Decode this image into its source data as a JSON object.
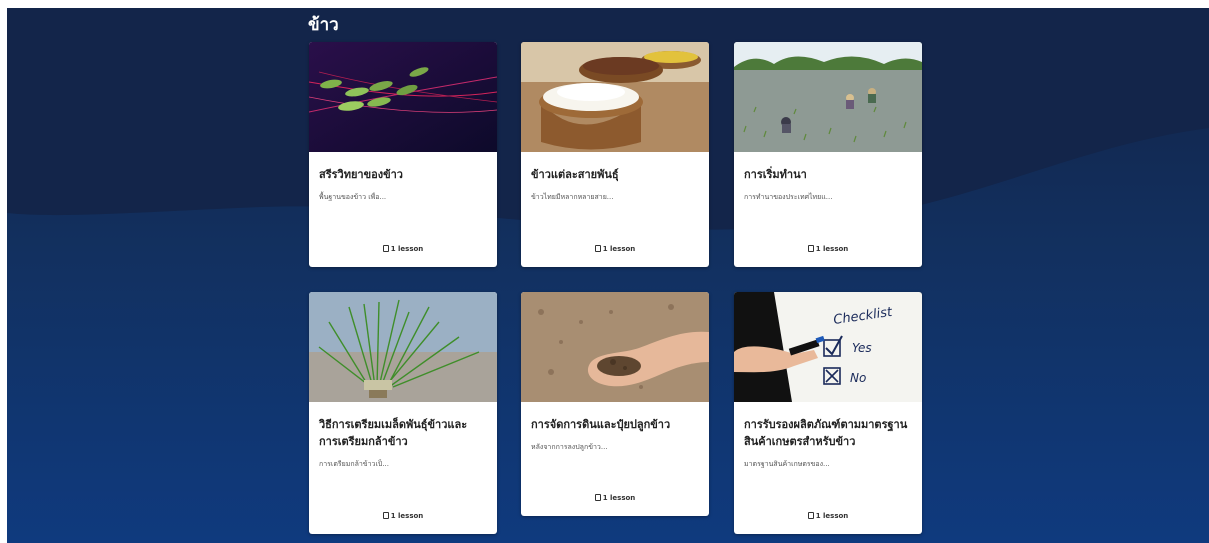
{
  "section": {
    "title": "ข้าว"
  },
  "courses": [
    {
      "title": "สรีรวิทยาของข้าว",
      "description": "พื้นฐานของข้าว เพื่อ...",
      "lessons": "1 lesson",
      "image": "rice-grain-closeup"
    },
    {
      "title": "ข้าวแต่ละสายพันธุ์",
      "description": "ข้าวไทยมีหลากหลายสาย...",
      "lessons": "1 lesson",
      "image": "rice-bowls"
    },
    {
      "title": "การเริ่มทำนา",
      "description": "การทำนาของประเทศไทยแ...",
      "lessons": "1 lesson",
      "image": "rice-planting-field"
    },
    {
      "title": "วิธีการเตรียมเมล็ดพันธุ์ข้าวและการเตรียมกล้าข้าว",
      "description": "การเตรียมกล้าข้าวเป็...",
      "lessons": "1 lesson",
      "image": "rice-seedlings"
    },
    {
      "title": "การจัดการดินและปุ๋ยปลูกข้าว",
      "description": "หลังจากการลงปลูกข้าว...",
      "lessons": "1 lesson",
      "image": "soil-in-hand"
    },
    {
      "title": "การรับรองผลิตภัณฑ์ตามมาตรฐานสินค้าเกษตรสำหรับข้าว",
      "description": "มาตรฐานสินค้าเกษตรของ...",
      "lessons": "1 lesson",
      "image": "checklist-yes-no"
    }
  ],
  "checklist_image_text": {
    "title": "Checklist",
    "yes": "Yes",
    "no": "No"
  },
  "colors": {
    "background_top": "#132347",
    "background_bottom": "#0f3a7e",
    "card": "#ffffff"
  }
}
